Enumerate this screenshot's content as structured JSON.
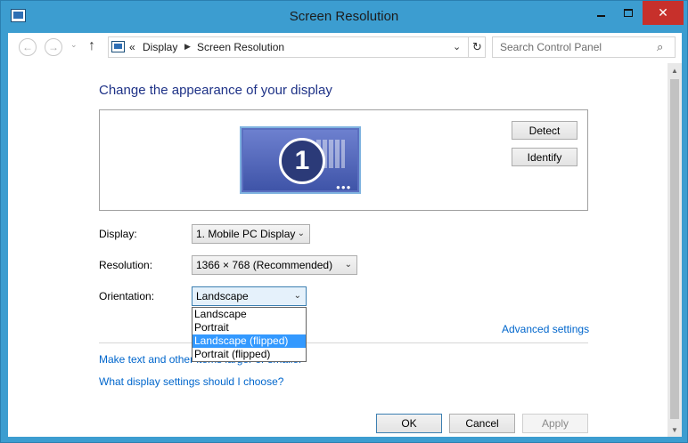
{
  "window": {
    "title": "Screen Resolution"
  },
  "window_controls": {
    "close_glyph": "✕"
  },
  "address_bar": {
    "back_glyph": "←",
    "forward_glyph": "→",
    "up_glyph": "↑",
    "overflow": "«",
    "crumbs": [
      "Display",
      "Screen Resolution"
    ],
    "separator": "▶",
    "dropdown_glyph": "⌄",
    "refresh_glyph": "↻",
    "search_placeholder": "Search Control Panel",
    "search_glyph": "⌕"
  },
  "main": {
    "heading": "Change the appearance of your display",
    "monitor_number": "1",
    "monitor_dots": "●●●",
    "detect_label": "Detect",
    "identify_label": "Identify"
  },
  "settings": {
    "display_label": "Display:",
    "display_value": "1. Mobile PC Display",
    "resolution_label": "Resolution:",
    "resolution_value": "1366 × 768 (Recommended)",
    "orientation_label": "Orientation:",
    "orientation_value": "Landscape",
    "orientation_options": [
      "Landscape",
      "Portrait",
      "Landscape (flipped)",
      "Portrait (flipped)"
    ],
    "highlighted_option": "Landscape (flipped)",
    "arrow_glyph": "⌄"
  },
  "links": {
    "advanced": "Advanced settings",
    "text_size": "Make text and other items larger or smaller",
    "help": "What display settings should I choose?"
  },
  "footer": {
    "ok": "OK",
    "cancel": "Cancel",
    "apply": "Apply"
  },
  "scrollbar": {
    "up_glyph": "▲",
    "down_glyph": "▼"
  },
  "colors": {
    "titlebar": "#3c9dd0",
    "close_button": "#c7302b",
    "heading": "#1e3287",
    "link": "#0066cc",
    "selection": "#3399ff"
  }
}
